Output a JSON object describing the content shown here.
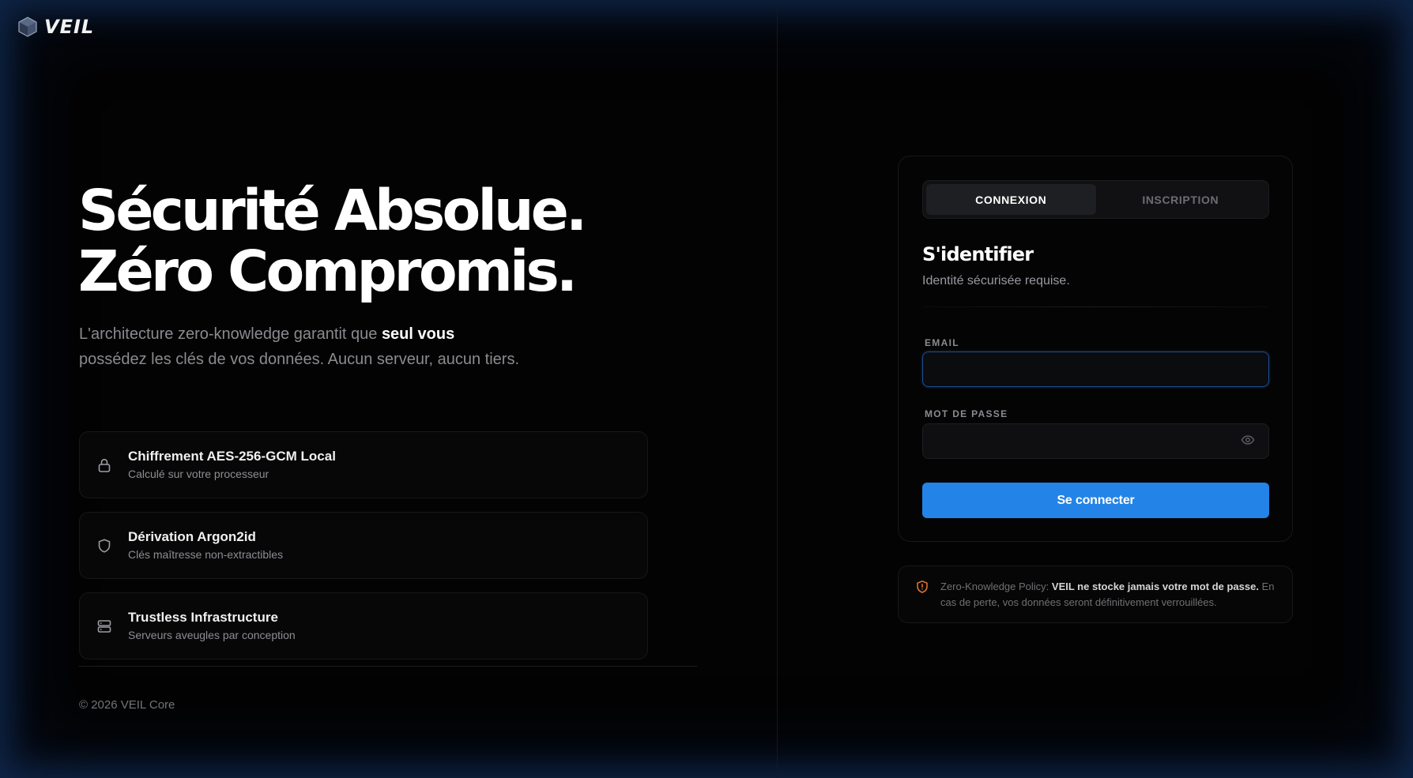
{
  "brand": {
    "name": "VEIL",
    "logo_icon": "cube-icon"
  },
  "hero": {
    "title_line1": "Sécurité Absolue.",
    "title_line2": "Zéro Compromis.",
    "subtitle_pre": "L'architecture zero-knowledge garantit que ",
    "subtitle_strong": "seul vous",
    "subtitle_post": " possédez les clés de vos données. Aucun serveur, aucun tiers."
  },
  "features": [
    {
      "icon": "lock-icon",
      "title": "Chiffrement AES-256-GCM Local",
      "desc": "Calculé sur votre processeur"
    },
    {
      "icon": "shield-icon",
      "title": "Dérivation Argon2id",
      "desc": "Clés maîtresse non-extractibles"
    },
    {
      "icon": "server-icon",
      "title": "Trustless Infrastructure",
      "desc": "Serveurs aveugles par conception"
    }
  ],
  "footer": {
    "copyright": "© 2026 VEIL Core"
  },
  "auth": {
    "tabs": [
      {
        "label": "CONNEXION",
        "active": true
      },
      {
        "label": "INSCRIPTION",
        "active": false
      }
    ],
    "title": "S'identifier",
    "subtitle": "Identité sécurisée requise.",
    "email": {
      "label": "EMAIL",
      "value": "",
      "placeholder": ""
    },
    "password": {
      "label": "MOT DE PASSE",
      "value": "",
      "placeholder": "",
      "toggle_icon": "eye-icon"
    },
    "submit_label": "Se connecter"
  },
  "policy": {
    "icon": "shield-alert-icon",
    "prefix": "Zero-Knowledge Policy: ",
    "strong": "VEIL ne stocke jamais votre mot de passe.",
    "suffix": " En cas de perte, vos données seront définitivement verrouillées."
  },
  "colors": {
    "accent": "#2383e6",
    "background": "#030303",
    "glow": "#183a6e",
    "warning": "#e8772e"
  }
}
